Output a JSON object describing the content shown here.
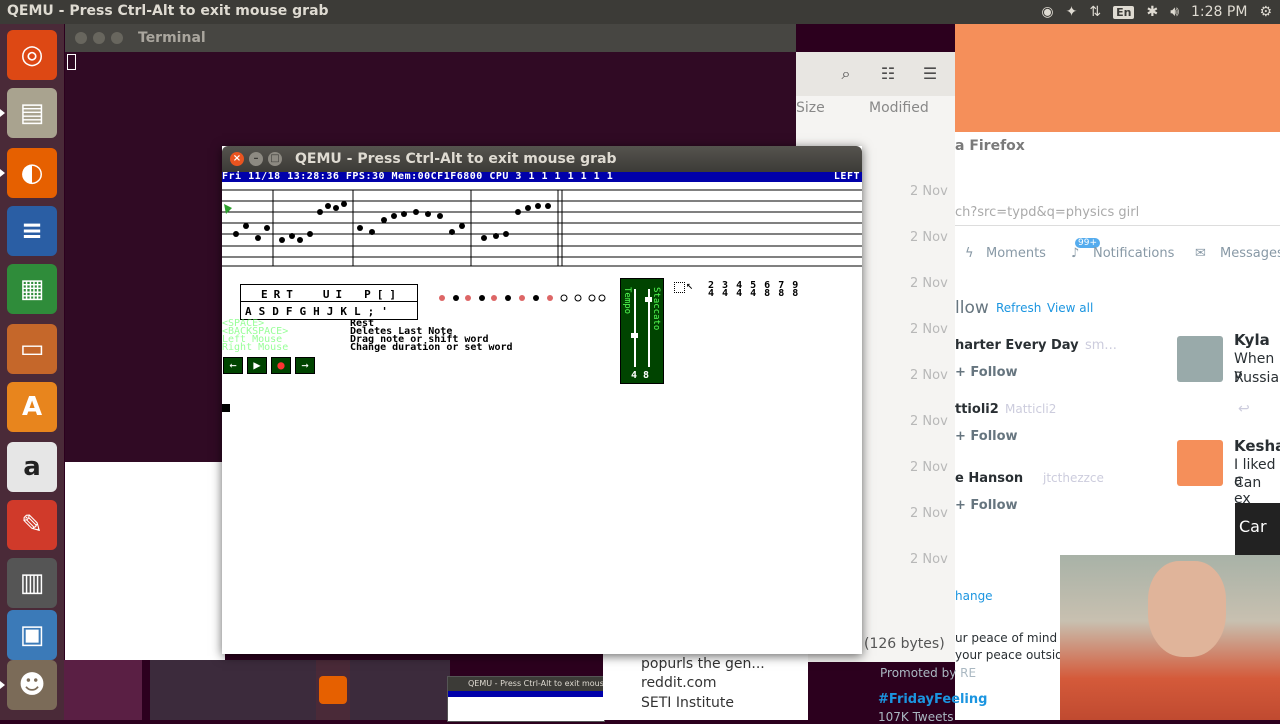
{
  "topbar": {
    "title": "QEMU - Press Ctrl-Alt to exit mouse grab",
    "lang": "En",
    "time": "1:28 PM"
  },
  "launcher": {
    "items": [
      "ubuntu-icon",
      "files-icon",
      "firefox-icon",
      "writer-icon",
      "calc-icon",
      "impress-icon",
      "software-center-icon",
      "amazon-icon",
      "tool-icon",
      "stack-icon",
      "drawer-icon",
      "gimp-icon"
    ]
  },
  "terminal": {
    "title": "Terminal"
  },
  "files": {
    "col_size": "Size",
    "col_modified": "Modified",
    "dates": [
      "2 Nov",
      "2 Nov",
      "2 Nov",
      "2 Nov",
      "2 Nov",
      "2 Nov",
      "2 Nov",
      "2 Nov",
      "2 Nov"
    ],
    "bytes": "(126 bytes)"
  },
  "firefox": {
    "tab_title": "a Firefox",
    "url": "ch?src=typd&q=physics girl",
    "nav": {
      "moments": "Moments",
      "notifications": "Notifications",
      "badge": "99+",
      "messages": "Messages"
    },
    "who_to_follow": "llow",
    "refresh": "Refresh",
    "view_all": "View all",
    "suggestions": [
      {
        "name": "harter Every Day",
        "handle": "sm...",
        "follow": "Follow"
      },
      {
        "name": "ttioli2",
        "handle": "Matticli2",
        "follow": "Follow"
      },
      {
        "name": "e Hanson",
        "handle": "jtcthezzce",
        "follow": "Follow"
      }
    ],
    "change": "hange",
    "trend_text1": "ur peace of mind o",
    "trend_text2": "your peace outside",
    "promoted": "Promoted by RE",
    "hashtag": "#FridayFeeling",
    "tweets_count": "107K Tweets",
    "side": [
      {
        "name": "Kyla",
        "line1": "When y",
        "line2": "Russian"
      },
      {
        "name": "Keshav",
        "line1": "I liked a",
        "line2": "Can ex"
      }
    ],
    "card_text": "Car"
  },
  "reddit_menu": {
    "items": [
      "popurls  the gen...",
      "reddit.com",
      "SETI Institute"
    ]
  },
  "qemu": {
    "title": "QEMU - Press Ctrl-Alt to exit mouse grab",
    "status": "Fri 11/18 13:28:36 FPS:30 Mem:00CF1F6800 CPU 3 1 1 1 1 1 1 1",
    "status_right": "LEFT",
    "keys_top": [
      "E",
      "R",
      "T",
      "U",
      "I",
      "P",
      "[",
      "]"
    ],
    "keys_bottom": [
      "A",
      "S",
      "D",
      "F",
      "G",
      "H",
      "J",
      "K",
      "L",
      ";",
      "'"
    ],
    "help": [
      {
        "key": "<SPACE>",
        "desc": "Rest"
      },
      {
        "key": "<BACKSPACE>",
        "desc": "Deletes Last Note"
      },
      {
        "key": "Left Mouse",
        "desc": "Drag note or shift word"
      },
      {
        "key": "Right Mouse",
        "desc": "Change duration or set word"
      }
    ],
    "meter": {
      "left": "Tempo",
      "right": "Staccato",
      "values": "4 8"
    },
    "nums_top": "2 3 4 5 6 7 9",
    "nums_bottom": "4 4 4 4 8 8 8"
  },
  "colors": {
    "accent": "#f58f5a",
    "qemu_status": "#0000aa",
    "green": "#55ff55",
    "dark_green": "#004400"
  }
}
